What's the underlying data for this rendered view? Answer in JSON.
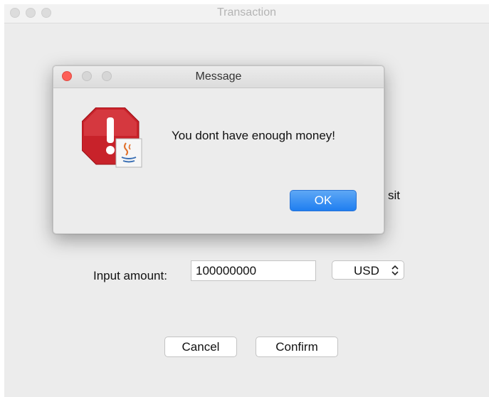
{
  "window": {
    "title": "Transaction",
    "partial_label": "sit",
    "amount_label": "Input amount:",
    "amount_value": "100000000",
    "currency": "USD",
    "cancel_label": "Cancel",
    "confirm_label": "Confirm"
  },
  "dialog": {
    "title": "Message",
    "message": "You dont have enough money!",
    "ok_label": "OK",
    "icon": "java-error-alert-icon"
  },
  "colors": {
    "close": "#fd5f57",
    "minimize_inactive": "#d3d3d3",
    "ok_button": "#1f7ef0"
  }
}
